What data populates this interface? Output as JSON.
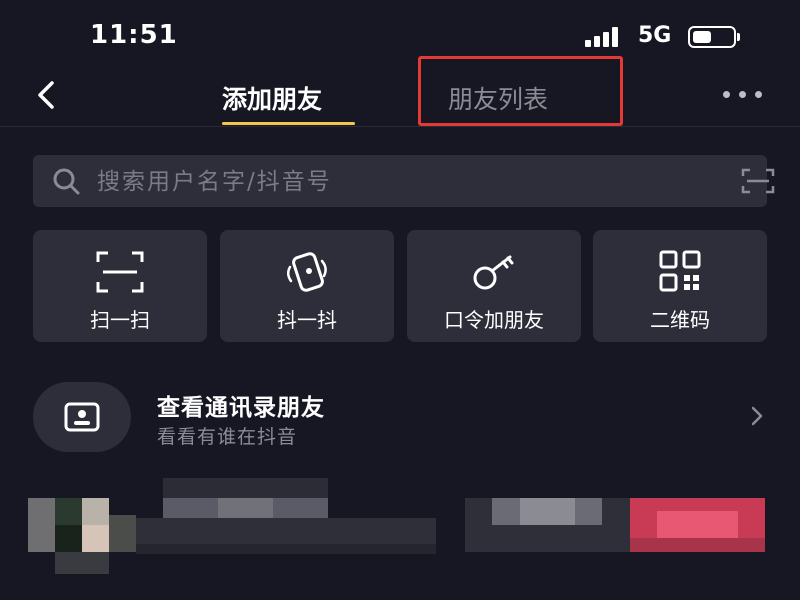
{
  "status_bar": {
    "time": "11:51",
    "network": "5G",
    "icons": [
      "signal-bars-icon",
      "battery-icon"
    ]
  },
  "nav": {
    "back_icon": "chevron-left-icon",
    "tabs": [
      {
        "label": "添加朋友",
        "active": true
      },
      {
        "label": "朋友列表",
        "active": false
      }
    ],
    "more_icon": "more-dots-icon",
    "accent_color": "#f2c94c",
    "highlight_color": "#e53935"
  },
  "search": {
    "placeholder": "搜索用户名字/抖音号",
    "icon": "search-icon",
    "scan_icon": "scan-icon"
  },
  "quick_actions": [
    {
      "label": "扫一扫",
      "icon": "scan-icon"
    },
    {
      "label": "抖一抖",
      "icon": "shake-phone-icon"
    },
    {
      "label": "口令加朋友",
      "icon": "key-icon"
    },
    {
      "label": "二维码",
      "icon": "qr-code-icon"
    }
  ],
  "contacts_entry": {
    "title": "查看通讯录朋友",
    "subtitle": "看看有谁在抖音",
    "icon": "contact-card-icon",
    "chevron": "chevron-right-icon"
  },
  "theme": {
    "background": "#161722",
    "card": "#2d2e39"
  }
}
